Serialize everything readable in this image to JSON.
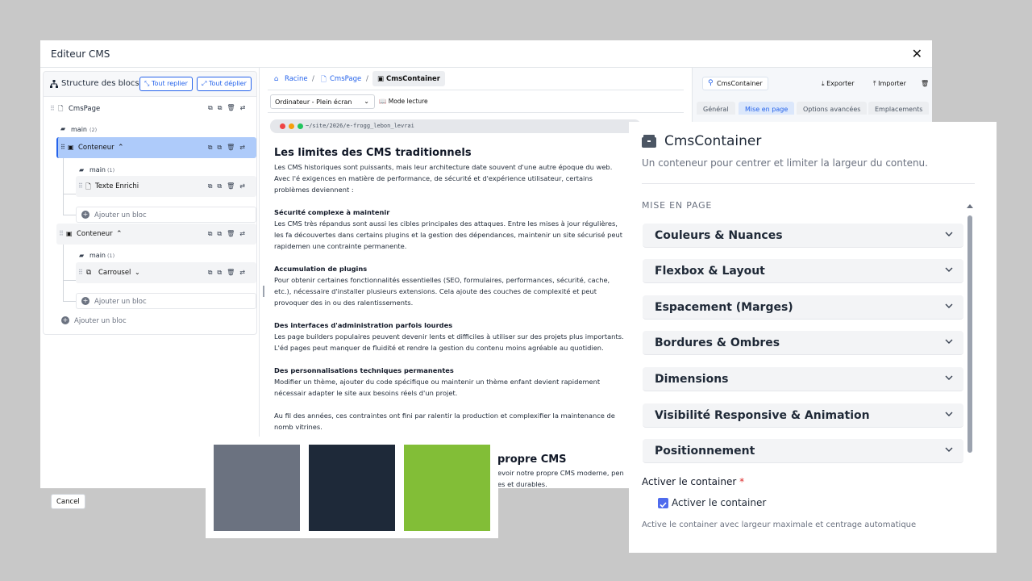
{
  "editor": {
    "title": "Editeur CMS",
    "cancel_label": "Cancel"
  },
  "structure": {
    "title": "Structure des blocs",
    "collapse_all": "Tout replier",
    "expand_all": "Tout déplier",
    "root": "CmsPage",
    "main_label": "main",
    "main_count": "(2)",
    "container1": "Conteneur",
    "c1_main_label": "main",
    "c1_main_count": "(1)",
    "rich_text": "Texte Enrichi",
    "add_block": "Ajouter un bloc",
    "container2": "Conteneur",
    "c2_main_label": "main",
    "c2_main_count": "(1)",
    "carousel": "Carrousel",
    "add_block2": "Ajouter un bloc",
    "add_block_root": "Ajouter un bloc"
  },
  "breadcrumb": {
    "root": "Racine",
    "page": "CmsPage",
    "current": "CmsContainer"
  },
  "toolbar": {
    "viewport": "Ordinateur - Plein écran",
    "read_mode": "Mode lecture"
  },
  "preview": {
    "url": "~/site/2026/e-frogg_lebon_levrai",
    "h1": "Les limites des CMS traditionnels",
    "intro": "Les CMS historiques sont puissants, mais leur architecture date souvent d'une autre époque du web. Avec l'é exigences en matière de performance, de sécurité et d'expérience utilisateur, certains problèmes deviennent :",
    "s1_title": "Sécurité complexe à maintenir",
    "s1_text": "Les CMS très répandus sont aussi les cibles principales des attaques. Entre les mises à jour régulières, les fa découvertes dans certains plugins et la gestion des dépendances, maintenir un site sécurisé peut rapidemen une contrainte permanente.",
    "s2_title": "Accumulation de plugins",
    "s2_text": "Pour obtenir certaines fonctionnalités essentielles (SEO, formulaires, performances, sécurité, cache, etc.), nécessaire d'installer plusieurs extensions. Cela ajoute des couches de complexité et peut provoquer des in ou des ralentissements.",
    "s3_title": "Des interfaces d'administration parfois lourdes",
    "s3_text": "Les page builders populaires peuvent devenir lents et difficiles à utiliser sur des projets plus importants. L'éd pages peut manquer de fluidité et rendre la gestion du contenu moins agréable au quotidien.",
    "s4_title": "Des personnalisations techniques permanentes",
    "s4_text": "Modifier un thème, ajouter du code spécifique ou maintenir un thème enfant devient rapidement nécessair adapter le site aux besoins réels d'un projet.",
    "outro": "Au fil des années, ces contraintes ont fini par ralentir la production et complexifier la maintenance de nomb vitrines.",
    "h2_fragment": "propre CMS",
    "p2_line1": "evoir notre propre CMS moderne, pen",
    "p2_line2": "es et durables."
  },
  "inspector": {
    "chip": "CmsContainer",
    "export": "Exporter",
    "import": "Importer",
    "tabs": [
      "Général",
      "Mise en page",
      "Options avancées",
      "Emplacements"
    ]
  },
  "swatches": {
    "colors": [
      "#6b7280",
      "#1e2939",
      "#82be37"
    ]
  },
  "overlay": {
    "title": "CmsContainer",
    "subtitle": "Un conteneur pour centrer et limiter la largeur du contenu.",
    "section": "MISE EN PAGE",
    "accordions": [
      "Couleurs & Nuances",
      "Flexbox & Layout",
      "Espacement (Marges)",
      "Bordures & Ombres",
      "Dimensions",
      "Visibilité Responsive & Animation",
      "Positionnement"
    ],
    "field_label": "Activer le container",
    "required_mark": "*",
    "checkbox_label": "Activer le container",
    "help": "Active le container avec largeur maximale et centrage automatique",
    "checkbox_checked": true
  },
  "colors": {
    "accent": "#2563eb",
    "selected_row": "#aecbfa",
    "checkbox": "#4f6bed"
  }
}
